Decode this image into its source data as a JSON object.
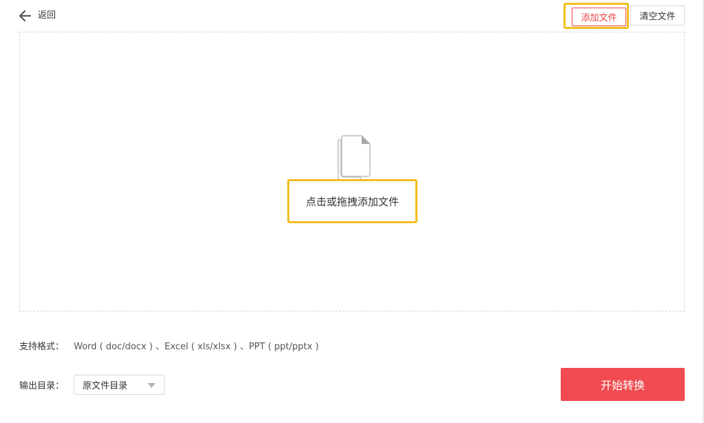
{
  "header": {
    "back_label": "返回",
    "back_icon": "arrow-left-icon"
  },
  "toolbar": {
    "add_files_label": "添加文件",
    "clear_files_label": "清空文件"
  },
  "dropzone": {
    "icon": "file-copy-icon",
    "hint": "点击或拖拽添加文件"
  },
  "formats": {
    "label": "支持格式：",
    "value": "Word ( doc/docx ) 、Excel ( xls/xlsx ) 、PPT ( ppt/pptx )"
  },
  "output": {
    "label": "输出目录：",
    "selected": "原文件目录"
  },
  "actions": {
    "start_label": "开始转换"
  },
  "colors": {
    "accent_red": "#e84545",
    "start_button": "#f04b50",
    "highlight": "#f2be1e"
  }
}
